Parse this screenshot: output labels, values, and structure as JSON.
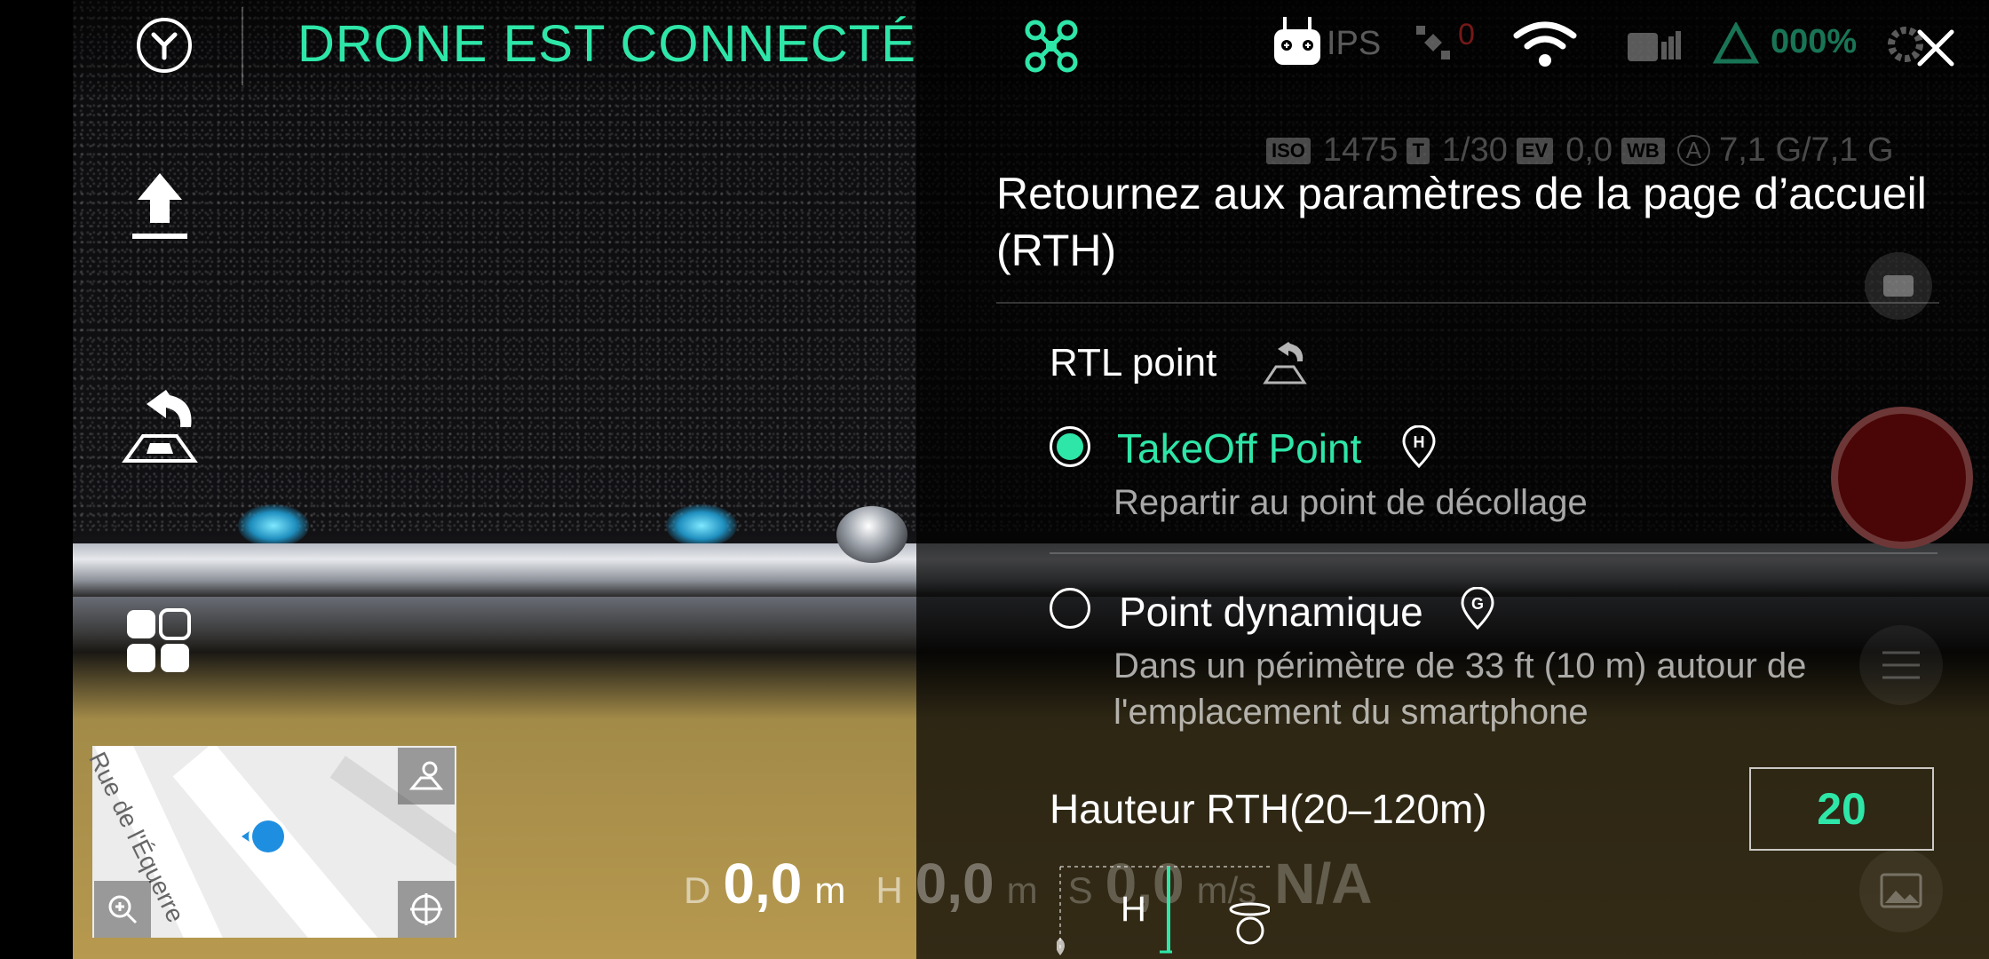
{
  "header": {
    "connection_status": "DRONE EST CONNECTÉ",
    "gps_label": "IPS",
    "satellite_count": "0",
    "signal_value": "000%"
  },
  "camera_params": {
    "iso_tag": "ISO",
    "iso": "1475",
    "shutter_tag": "T",
    "shutter": "1/30",
    "ev_tag": "EV",
    "ev": "0,0",
    "wb_tag": "WB",
    "auto_tag": "A",
    "storage": "7,1 G/7,1 G"
  },
  "map": {
    "street": "Rue de l'Équerre"
  },
  "telemetry": {
    "d_label": "D",
    "d_value": "0,0",
    "d_unit": "m",
    "h_label": "H",
    "h_value": "0,0",
    "h_unit": "m",
    "s_label": "S",
    "s_value": "0,0",
    "s_unit": "m/s",
    "na": "N/A"
  },
  "rth_panel": {
    "title": "Retournez aux paramètres de la page d’accueil (RTH)",
    "rtl_label": "RTL point",
    "options": [
      {
        "label": "TakeOff Point",
        "description": "Repartir au point de décollage",
        "selected": true
      },
      {
        "label": "Point dynamique",
        "description": "Dans un périmètre de 33 ft (10 m) autour de l'emplacement du smartphone",
        "selected": false
      }
    ],
    "height_label": "Hauteur RTH(20–120m)",
    "height_value": "20",
    "diagram_h": "H"
  },
  "colors": {
    "accent": "#2ee6a8",
    "record": "#4a0606"
  },
  "icons": {
    "home": "home-icon",
    "drone": "drone-icon",
    "rc": "remote-controller-icon",
    "satellite": "satellite-icon",
    "wifi": "wifi-icon",
    "rc_battery": "rc-battery-icon",
    "signal": "signal-icon",
    "gear": "gear-icon",
    "close": "close-icon",
    "takeoff": "takeoff-icon",
    "rth": "return-home-icon",
    "modes": "smart-modes-icon",
    "camera_switch": "camera-switch-icon",
    "record": "record-icon",
    "sliders": "sliders-icon",
    "gallery": "gallery-icon",
    "location_pin_h": "home-pin-icon",
    "location_pin_g": "gps-pin-icon"
  }
}
